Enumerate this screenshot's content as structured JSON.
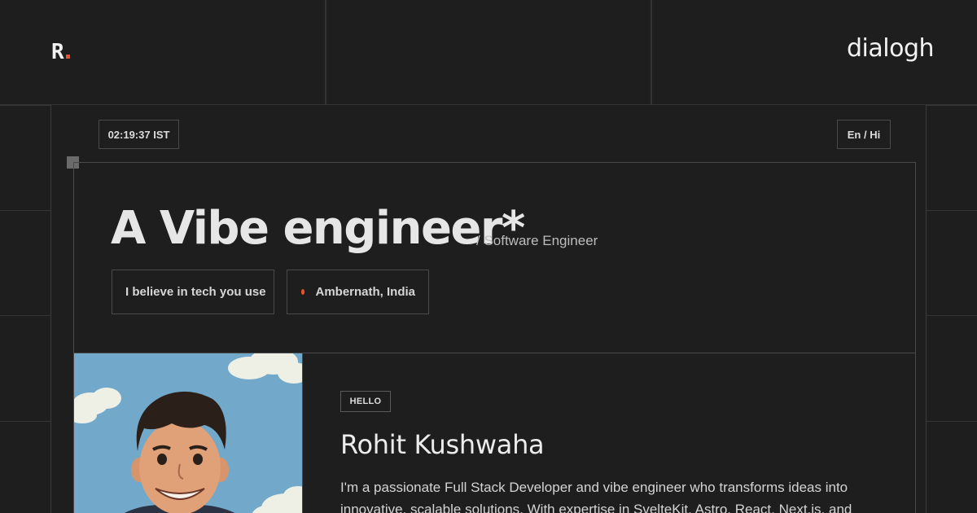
{
  "header": {
    "logo_letter": "R",
    "brand": "dialogh"
  },
  "panel": {
    "time": "02:19:37 IST",
    "language": "En / Hi"
  },
  "hero": {
    "headline": "A Vibe engineer*",
    "subtitle": "/ Software Engineer",
    "tag_belief": "I believe in tech you use",
    "tag_location": "Ambernath, India"
  },
  "about": {
    "hello_badge": "HELLO",
    "name": "Rohit Kushwaha",
    "bio": "I'm a passionate Full Stack Developer and vibe engineer who transforms ideas into innovative, scalable solutions. With expertise in SvelteKit, Astro, React, Next.js, and"
  },
  "icons": {
    "location_dot": "location-dot-icon",
    "logo_dot": "logo-dot-icon"
  },
  "colors": {
    "background": "#1e1e1e",
    "accent": "#e8512a",
    "border": "#4a4a4a",
    "text": "#e6e6e6",
    "sky": "#6fa6c7"
  }
}
